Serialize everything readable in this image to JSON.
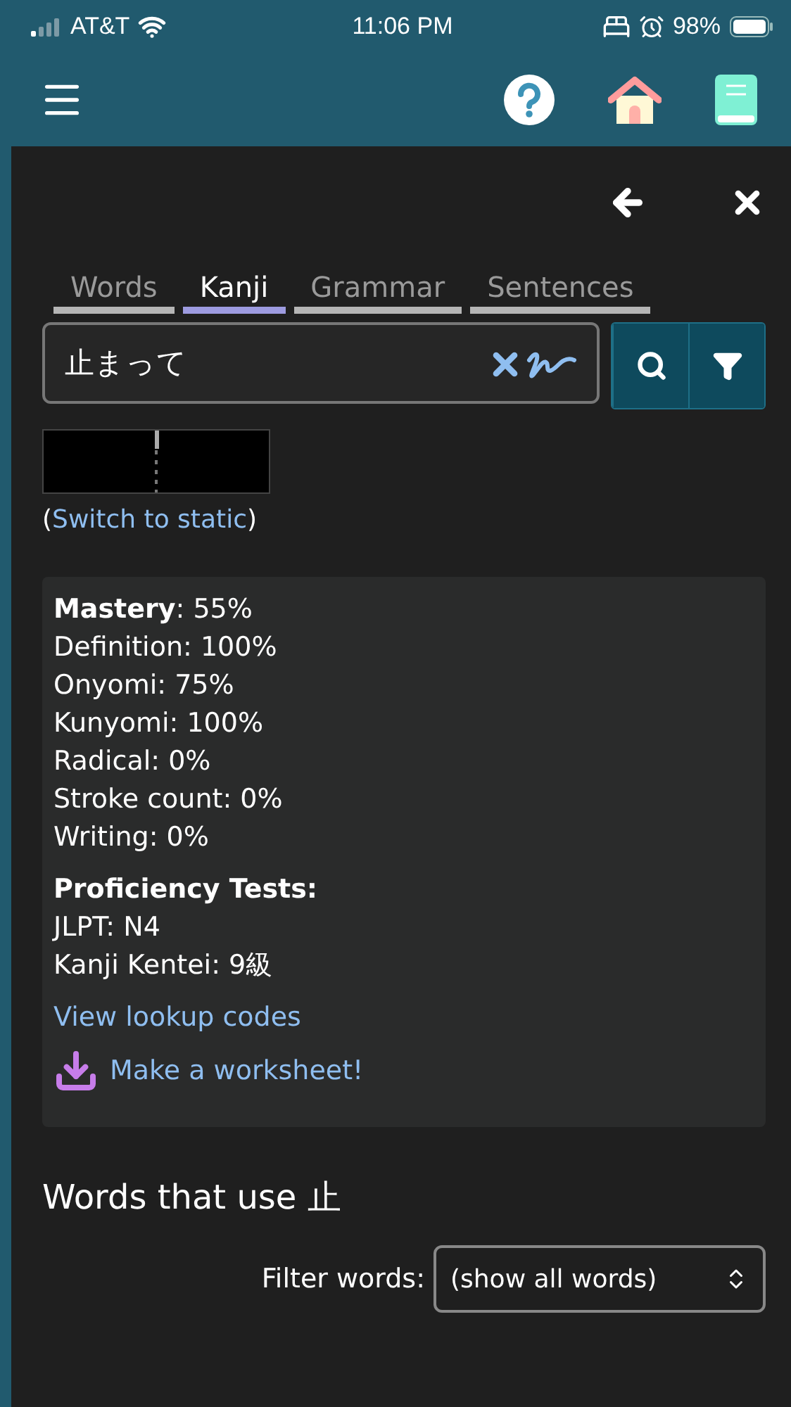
{
  "status_bar": {
    "carrier": "AT&T",
    "time": "11:06 PM",
    "battery": "98%"
  },
  "tabs": [
    {
      "label": "Words",
      "selected": false
    },
    {
      "label": "Kanji",
      "selected": true
    },
    {
      "label": "Grammar",
      "selected": false
    },
    {
      "label": "Sentences",
      "selected": false
    }
  ],
  "search": {
    "value": "止まって"
  },
  "animation": {
    "switch_open": "(",
    "switch_link": "Switch to static",
    "switch_close": ")"
  },
  "mastery": [
    "**Mastery**: 55%",
    "Definition: 100%",
    "Onyomi: 75%",
    "Kunyomi: 100%",
    "Radical: 0%",
    "Stroke count: 0%",
    "Writing: 0%"
  ],
  "proficiency": {
    "title": "Proficiency Tests:",
    "items": [
      "JLPT: N4",
      "Kanji Kentei: 9級"
    ]
  },
  "links": {
    "lookup": "View lookup codes",
    "worksheet": "Make a worksheet!"
  },
  "words_section": {
    "title": "Words that use 止",
    "filter_label": "Filter words:",
    "filter_value": "(show all words)"
  }
}
